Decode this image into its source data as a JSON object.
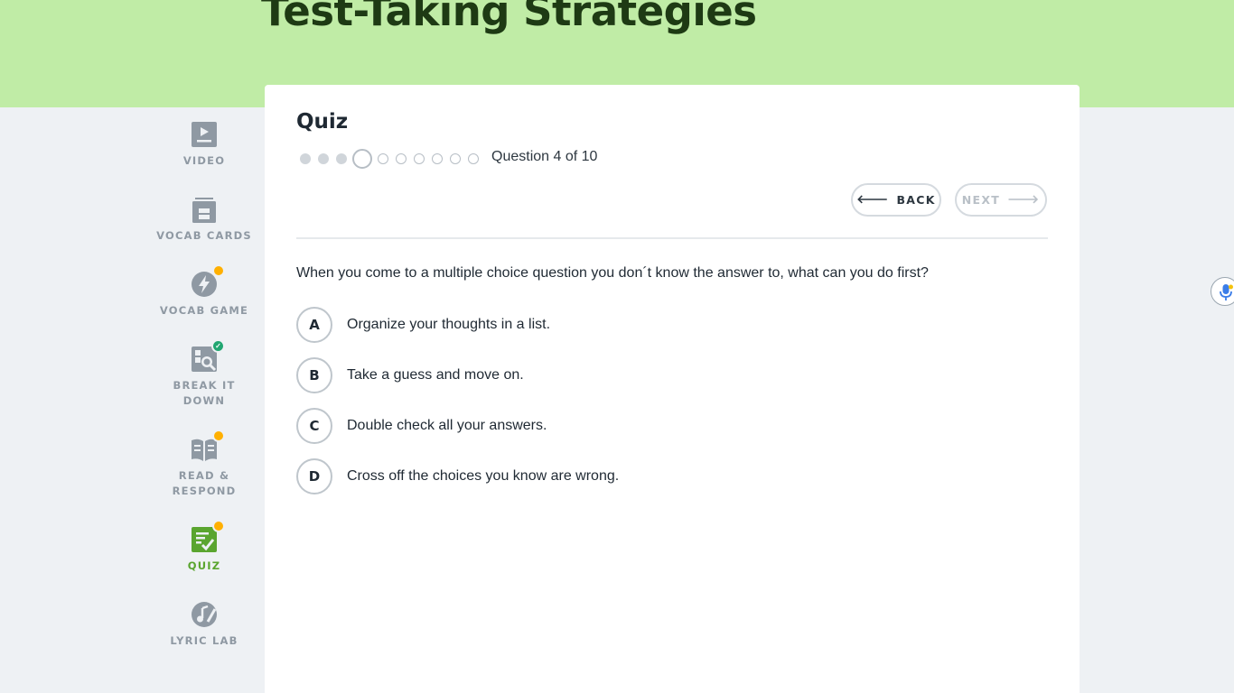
{
  "header": {
    "title": "Test-Taking Strategies"
  },
  "sidebar": {
    "items": [
      {
        "label": "VIDEO",
        "icon": "video-icon"
      },
      {
        "label": "VOCAB CARDS",
        "icon": "vocab-cards-icon"
      },
      {
        "label": "VOCAB GAME",
        "icon": "lightning-icon",
        "badge": "notification-dot"
      },
      {
        "label": "BREAK IT DOWN",
        "icon": "magnify-grid-icon",
        "badge": "complete-check"
      },
      {
        "label": "READ & RESPOND",
        "icon": "book-icon",
        "badge": "notification-dot"
      },
      {
        "label": "QUIZ",
        "icon": "quiz-icon",
        "badge": "notification-dot",
        "active": true
      },
      {
        "label": "LYRIC LAB",
        "icon": "music-note-icon"
      }
    ]
  },
  "quiz": {
    "heading": "Quiz",
    "progress_text": "Question 4 of 10",
    "current_question": 4,
    "total_questions": 10,
    "back_label": "BACK",
    "next_label": "NEXT",
    "question": "When you come to a multiple choice question you don´t know the answer to, what can you do first?",
    "options": [
      {
        "letter": "A",
        "text": "Organize your thoughts in a list."
      },
      {
        "letter": "B",
        "text": "Take a guess and move on."
      },
      {
        "letter": "C",
        "text": "Double check all your answers."
      },
      {
        "letter": "D",
        "text": "Cross off the choices you know are wrong."
      }
    ]
  },
  "colors": {
    "hero_bg": "#c0eca6",
    "title": "#1e3a14",
    "active_nav": "#5aa52f",
    "badge": "#ffb000",
    "check_badge": "#21a671",
    "nav_inactive": "#8f99a3"
  }
}
